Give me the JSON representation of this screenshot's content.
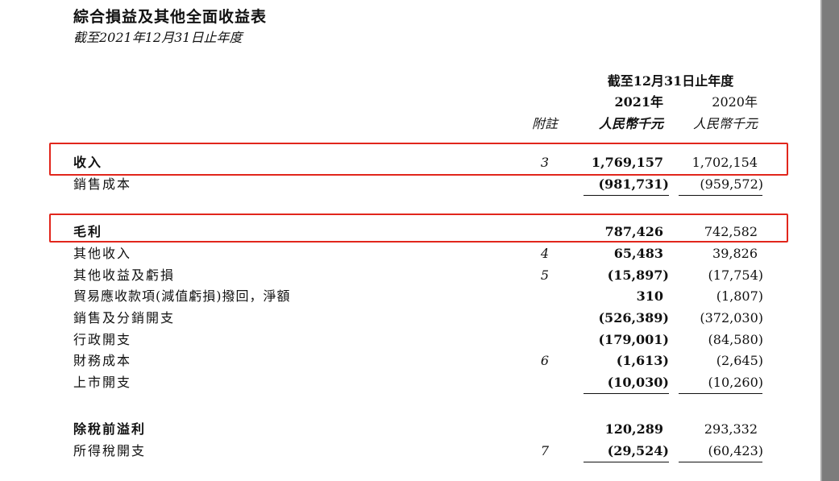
{
  "title": "綜合損益及其他全面收益表",
  "subtitle": "截至2021年12月31日止年度",
  "header": {
    "period": "截至12月31日止年度",
    "year_current": "2021年",
    "year_prior": "2020年",
    "note_label": "附註",
    "currency_current": "人民幣千元",
    "currency_prior": "人民幣千元"
  },
  "rows": [
    {
      "label": "收入",
      "note": "3",
      "v2021": "1,769,157",
      "v2020": "1,702,154",
      "bold": true,
      "highlighted": true
    },
    {
      "label": "銷售成本",
      "note": "",
      "v2021": "(981,731)",
      "v2020": "(959,572)"
    },
    {
      "label": "毛利",
      "note": "",
      "v2021": "787,426",
      "v2020": "742,582",
      "bold": true,
      "highlighted": true
    },
    {
      "label": "其他收入",
      "note": "4",
      "v2021": "65,483",
      "v2020": "39,826"
    },
    {
      "label": "其他收益及虧損",
      "note": "5",
      "v2021": "(15,897)",
      "v2020": "(17,754)"
    },
    {
      "label": "貿易應收款項(減值虧損)撥回，淨額",
      "note": "",
      "v2021": "310",
      "v2020": "(1,807)"
    },
    {
      "label": "銷售及分銷開支",
      "note": "",
      "v2021": "(526,389)",
      "v2020": "(372,030)"
    },
    {
      "label": "行政開支",
      "note": "",
      "v2021": "(179,001)",
      "v2020": "(84,580)"
    },
    {
      "label": "財務成本",
      "note": "6",
      "v2021": "(1,613)",
      "v2020": "(2,645)"
    },
    {
      "label": "上市開支",
      "note": "",
      "v2021": "(10,030)",
      "v2020": "(10,260)"
    },
    {
      "label": "除稅前溢利",
      "note": "",
      "v2021": "120,289",
      "v2020": "293,332",
      "bold": true
    },
    {
      "label": "所得稅開支",
      "note": "7",
      "v2021": "(29,524)",
      "v2020": "(60,423)"
    }
  ],
  "highlight_color": "#e1261c"
}
